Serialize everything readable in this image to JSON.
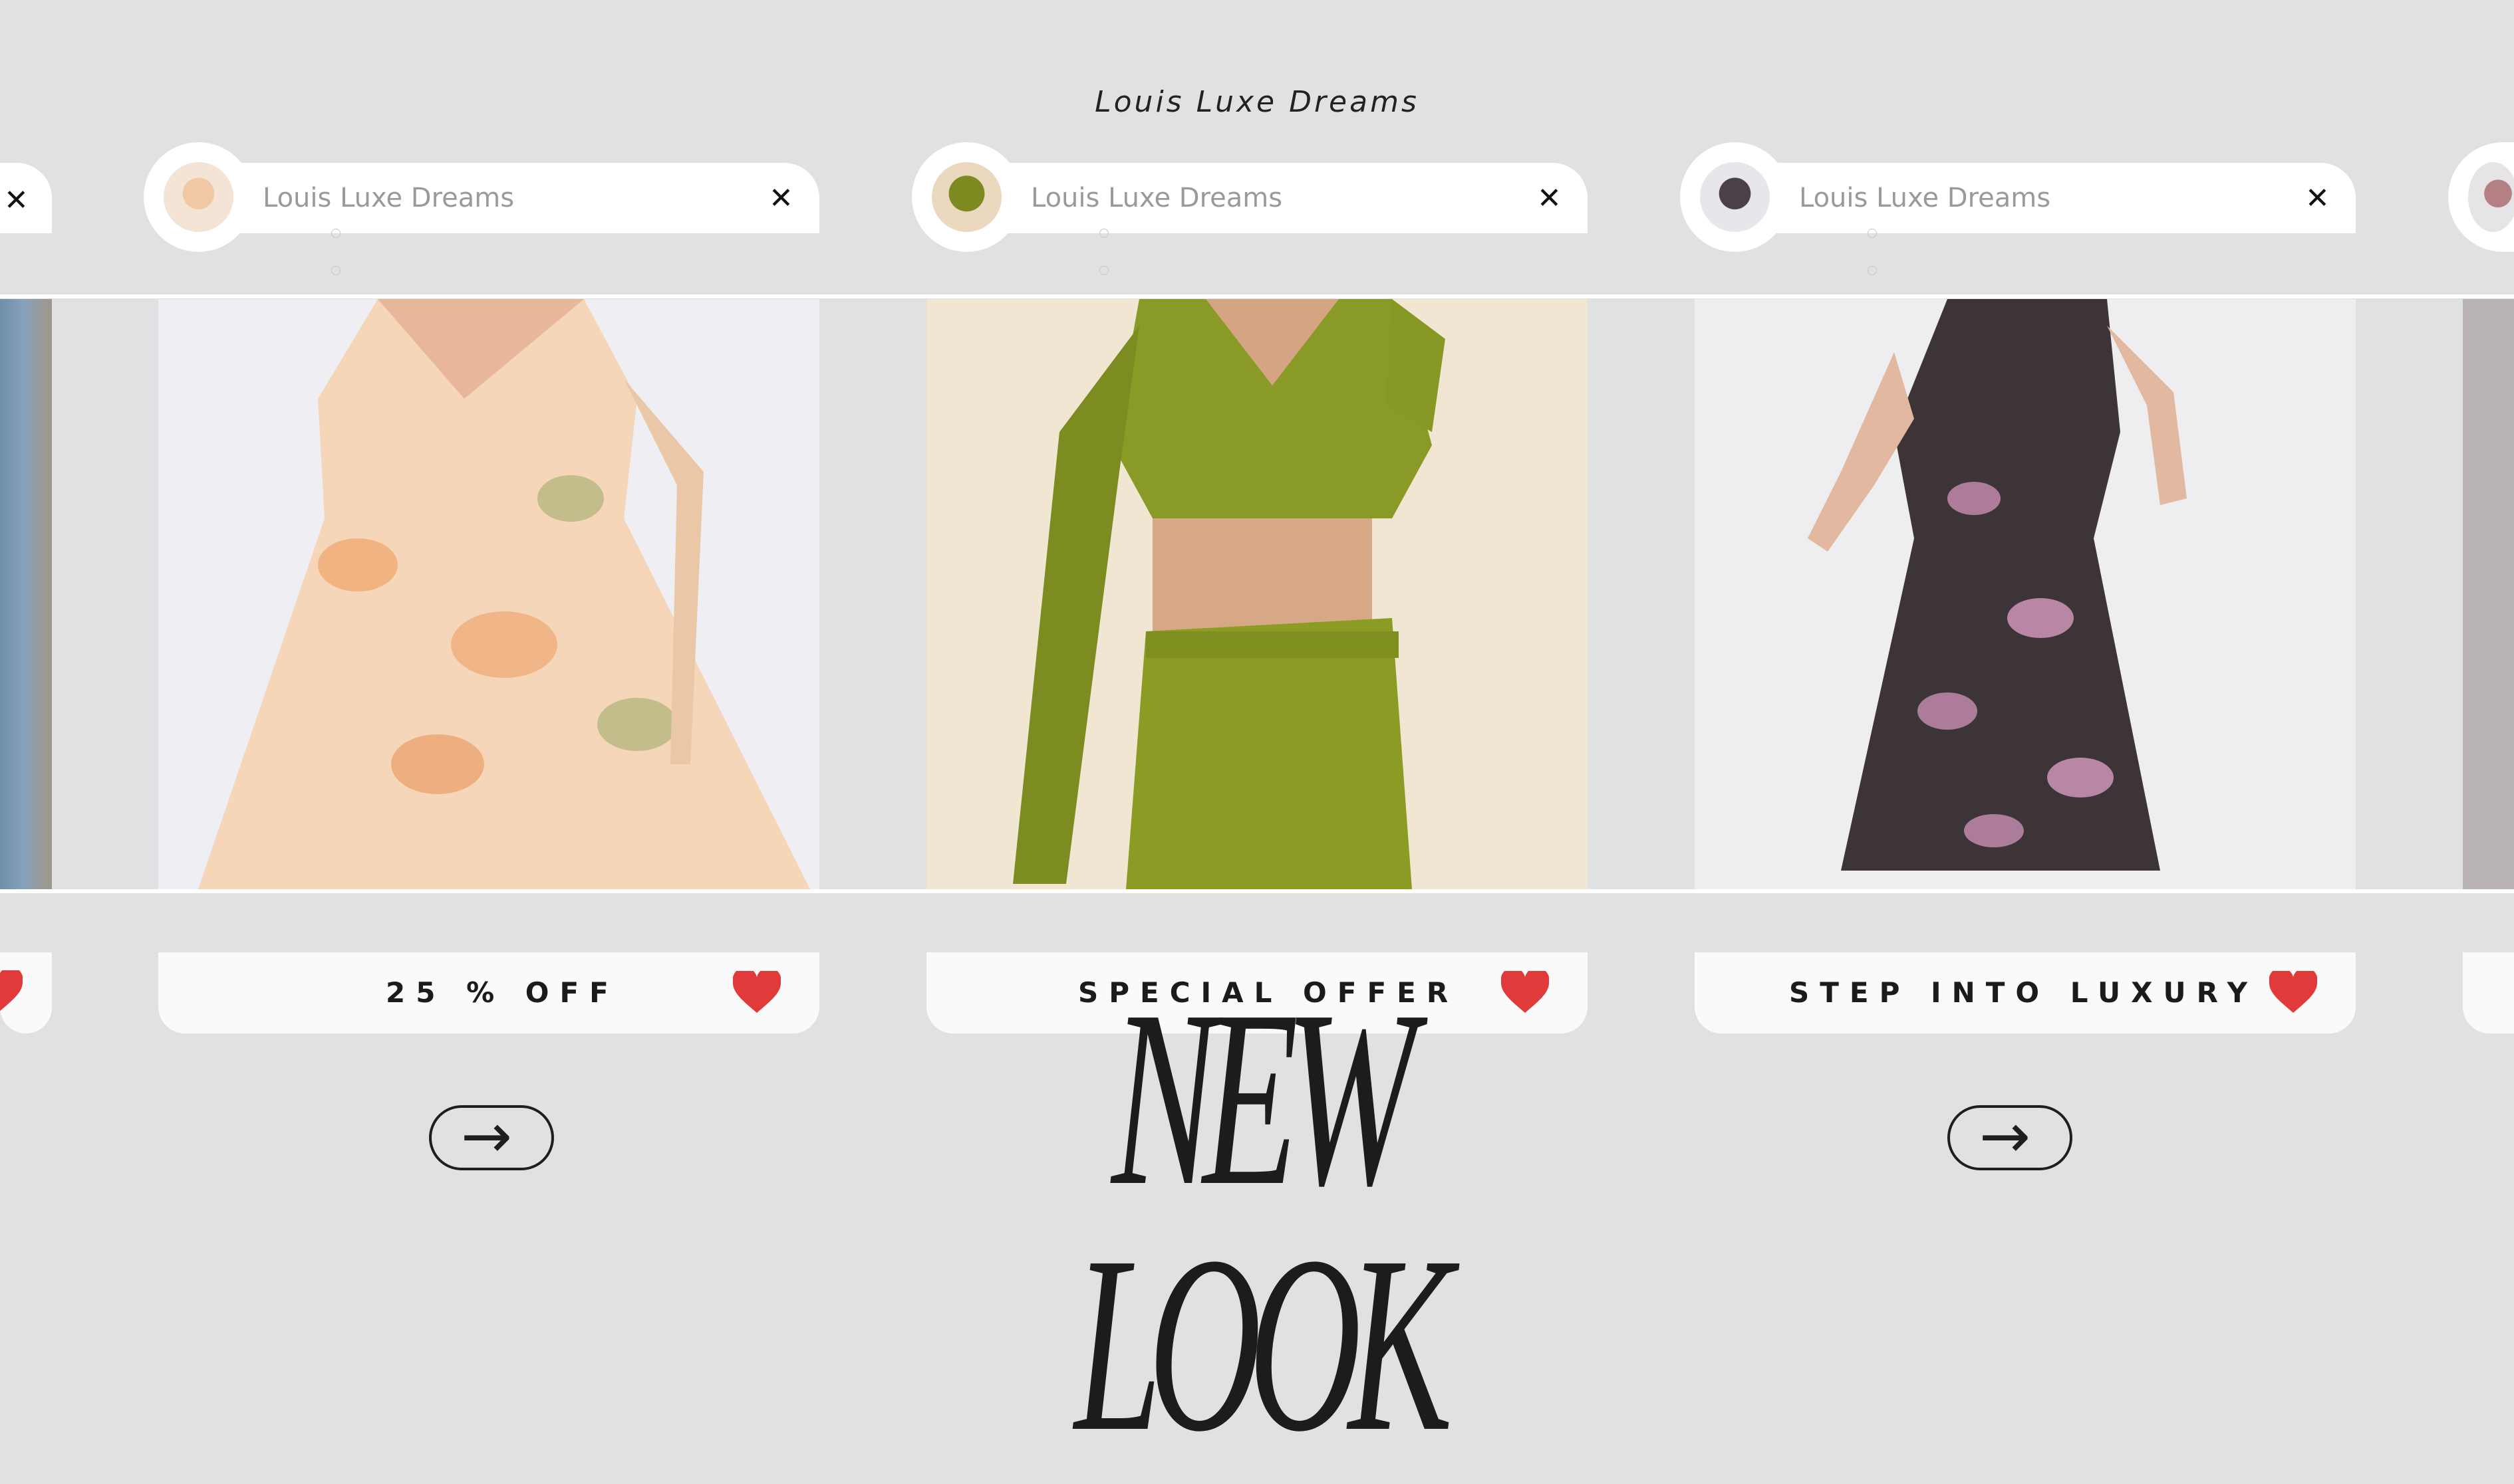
{
  "header": {
    "brand_title": "Louis Luxe Dreams"
  },
  "cards": [
    {
      "search_label": "Louis Luxe Dreams",
      "close_icon": "close-icon",
      "badge_text": "25 % OFF",
      "badge_icon": "heart-icon"
    },
    {
      "search_label": "Louis Luxe Dreams",
      "close_icon": "close-icon",
      "badge_text": "SPECIAL OFFER",
      "badge_icon": "heart-icon"
    },
    {
      "search_label": "Louis Luxe Dreams",
      "close_icon": "close-icon",
      "badge_text": "STEP INTO LUXURY",
      "badge_icon": "heart-icon"
    }
  ],
  "close_glyph": "✕",
  "arrow_glyph": "→",
  "headline": "NEW LOOK",
  "colors": {
    "background": "#e0e1e3",
    "heart": "#e03a3a",
    "text_dark": "#1b1b1b",
    "placeholder": "#9a9a9a"
  }
}
